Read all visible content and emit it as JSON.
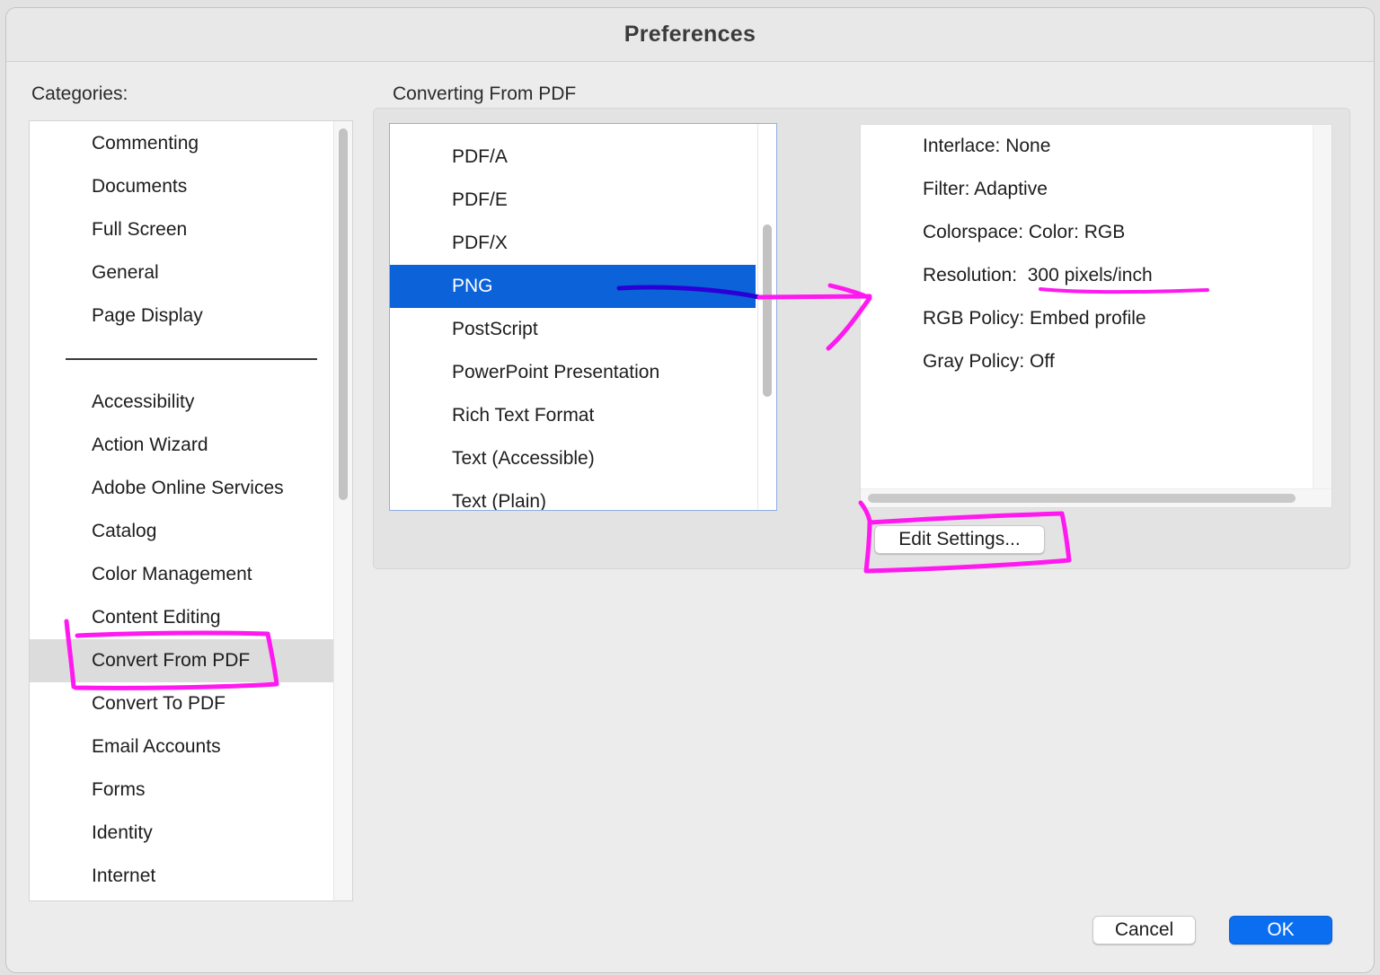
{
  "window": {
    "title": "Preferences"
  },
  "categories": {
    "label": "Categories:",
    "group_top": [
      "Commenting",
      "Documents",
      "Full Screen",
      "General",
      "Page Display"
    ],
    "group_bottom": [
      "Accessibility",
      "Action Wizard",
      "Adobe Online Services",
      "Catalog",
      "Color Management",
      "Content Editing",
      "Convert From PDF",
      "Convert To PDF",
      "Email Accounts",
      "Forms",
      "Identity",
      "Internet"
    ],
    "selected": "Convert From PDF"
  },
  "section": {
    "title": "Converting From PDF"
  },
  "formats": {
    "items": [
      "PDF/A",
      "PDF/E",
      "PDF/X",
      "PNG",
      "PostScript",
      "PowerPoint Presentation",
      "Rich Text Format",
      "Text (Accessible)",
      "Text (Plain)"
    ],
    "selected": "PNG"
  },
  "settings": {
    "lines": [
      "Interlace: None",
      "Filter: Adaptive",
      "Colorspace: Color: RGB",
      "Resolution:  300 pixels/inch",
      "RGB Policy: Embed profile",
      "Gray Policy: Off"
    ]
  },
  "buttons": {
    "edit_settings": "Edit Settings...",
    "cancel": "Cancel",
    "ok": "OK"
  },
  "colors": {
    "selection": "#0b62d9",
    "primary_button": "#0b6ef0",
    "annotation_magenta": "#ff19f0",
    "annotation_blue": "#2a00d6"
  },
  "icons": [
    "hand-drawn-box-annotation",
    "hand-drawn-underline-annotation",
    "hand-drawn-arrow-annotation"
  ]
}
